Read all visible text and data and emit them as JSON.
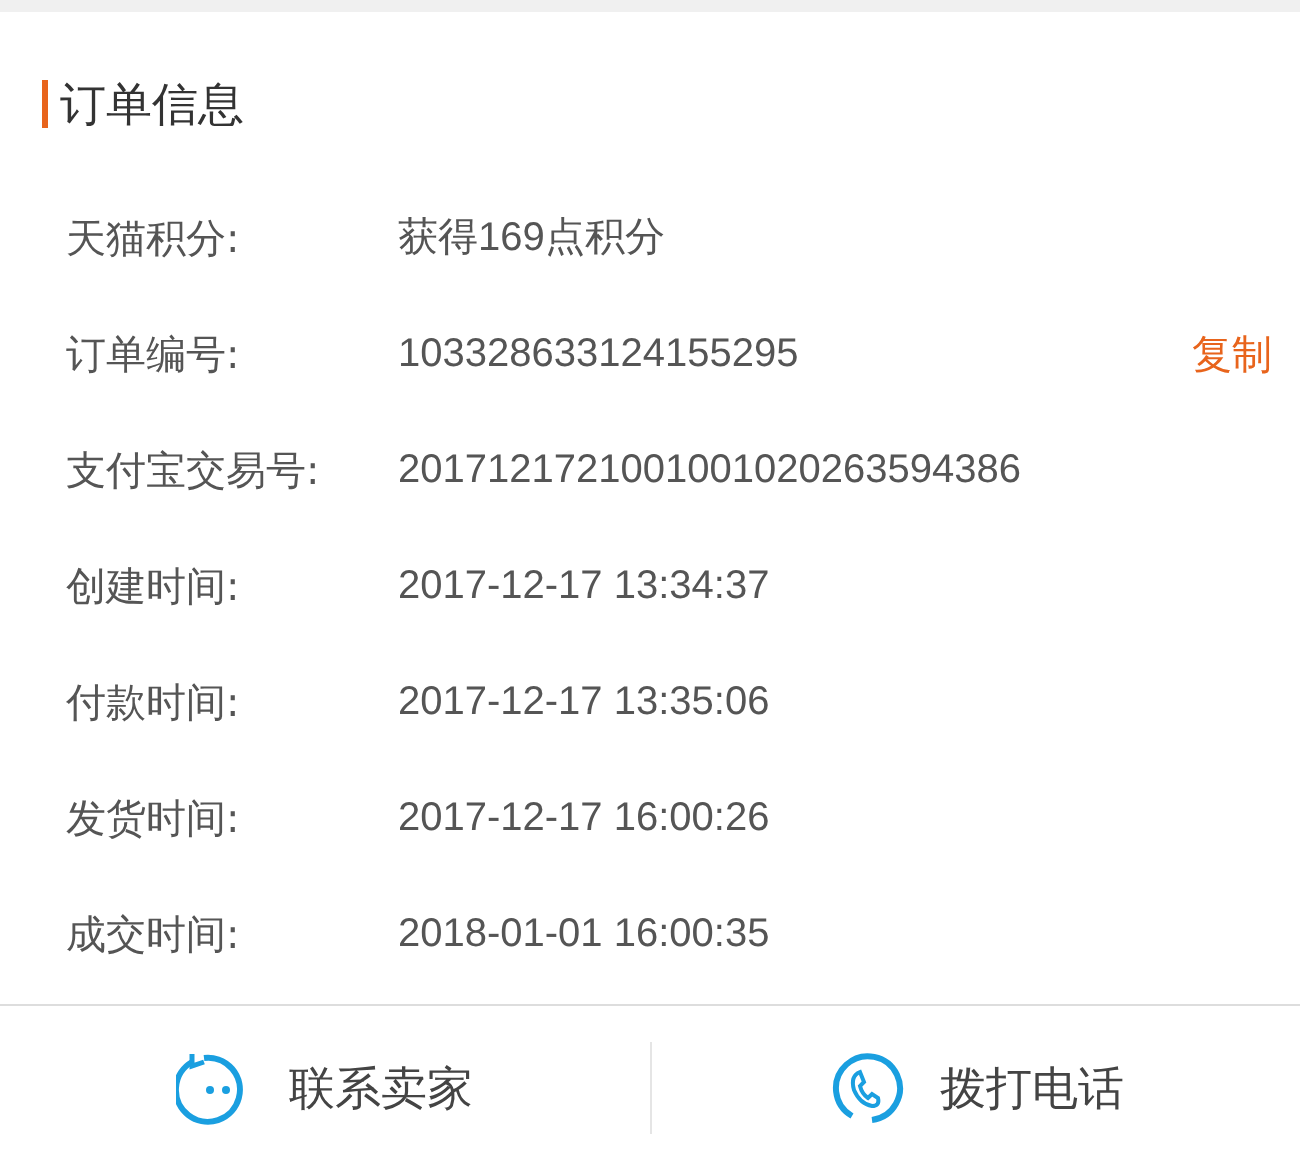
{
  "section": {
    "title": "订单信息"
  },
  "rows": [
    {
      "label": "天猫积分:",
      "value": "获得169点积分"
    },
    {
      "label": "订单编号:",
      "value": "103328633124155295",
      "action": "复制"
    },
    {
      "label": "支付宝交易号:",
      "value": "2017121721001001020263594386"
    },
    {
      "label": "创建时间:",
      "value": "2017-12-17 13:34:37"
    },
    {
      "label": "付款时间:",
      "value": "2017-12-17 13:35:06"
    },
    {
      "label": "发货时间:",
      "value": "2017-12-17 16:00:26"
    },
    {
      "label": "成交时间:",
      "value": "2018-01-01 16:00:35"
    }
  ],
  "bottom_bar": [
    {
      "kind": "chat",
      "label": "联系卖家"
    },
    {
      "kind": "phone",
      "label": "拨打电话"
    }
  ]
}
